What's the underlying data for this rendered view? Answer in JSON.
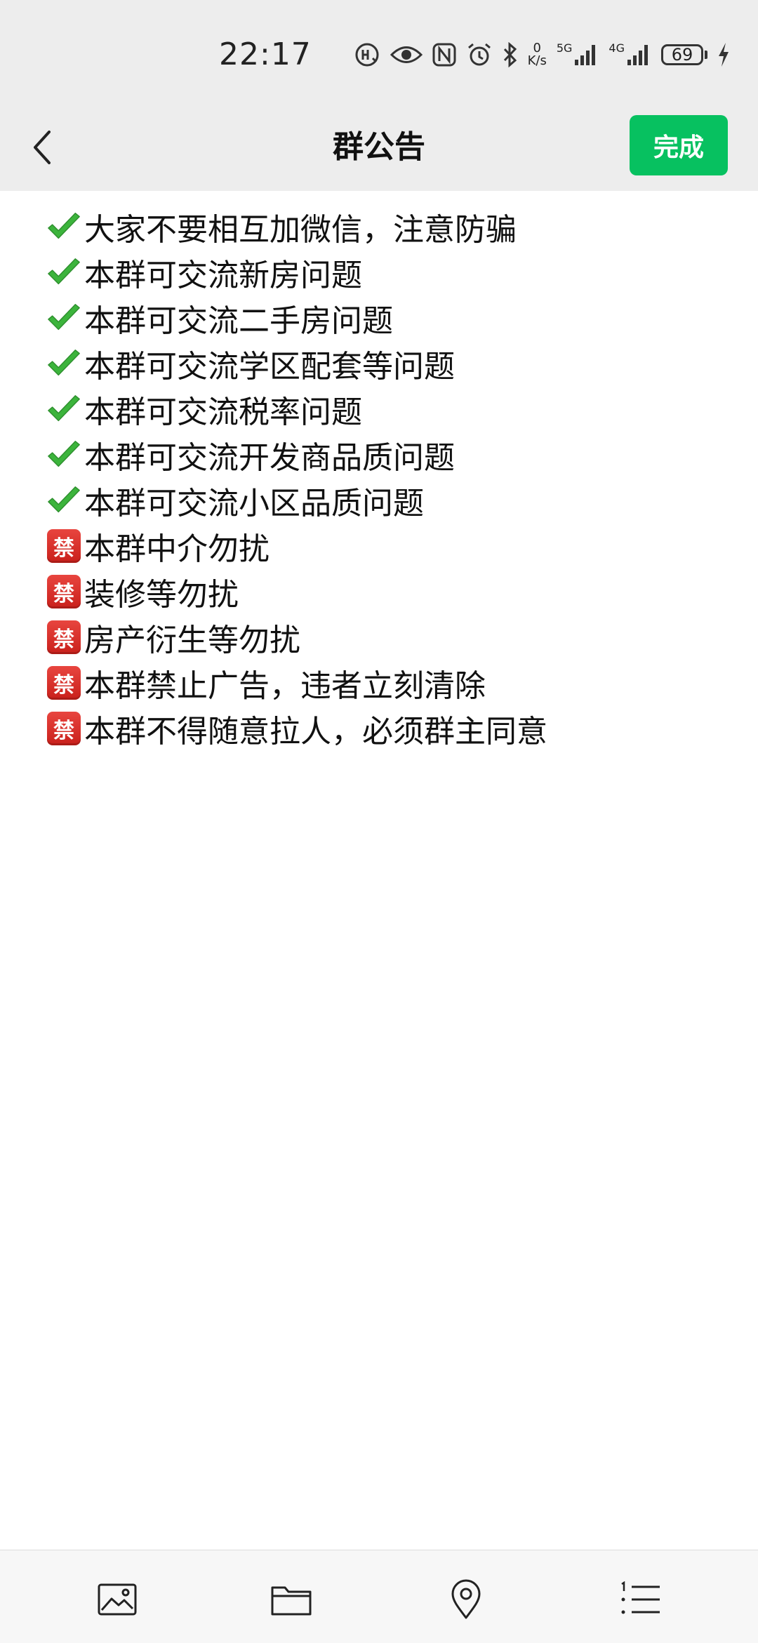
{
  "status_bar": {
    "time": "22:17",
    "net_speed_value": "0",
    "net_speed_unit": "K/s",
    "signal_1_label": "5G",
    "signal_2_label": "4G",
    "battery": "69",
    "icons": [
      "hd-call-icon",
      "eye-icon",
      "nfc-icon",
      "alarm-icon",
      "bluetooth-icon",
      "signal-icon",
      "battery-icon",
      "charging-icon"
    ]
  },
  "header": {
    "title": "群公告",
    "done_label": "完成",
    "accent_color": "#07c160"
  },
  "announcement": {
    "lines": [
      {
        "icon": "check-mark-icon",
        "text": "大家不要相互加微信，注意防骗"
      },
      {
        "icon": "check-mark-icon",
        "text": "本群可交流新房问题"
      },
      {
        "icon": "check-mark-icon",
        "text": "本群可交流二手房问题"
      },
      {
        "icon": "check-mark-icon",
        "text": "本群可交流学区配套等问题"
      },
      {
        "icon": "check-mark-icon",
        "text": "本群可交流税率问题"
      },
      {
        "icon": "check-mark-icon",
        "text": "本群可交流开发商品质问题"
      },
      {
        "icon": "check-mark-icon",
        "text": "本群可交流小区品质问题"
      },
      {
        "icon": "prohibited-icon",
        "text": "本群中介勿扰"
      },
      {
        "icon": "prohibited-icon",
        "text": "装修等勿扰"
      },
      {
        "icon": "prohibited-icon",
        "text": "房产衍生等勿扰"
      },
      {
        "icon": "prohibited-icon",
        "text": "本群禁止广告，违者立刻清除"
      },
      {
        "icon": "prohibited-icon",
        "text": "本群不得随意拉人，必须群主同意"
      }
    ],
    "ban_glyph": "禁"
  },
  "toolbar": {
    "icons": [
      "image-icon",
      "folder-icon",
      "location-icon",
      "numbered-list-icon"
    ]
  }
}
